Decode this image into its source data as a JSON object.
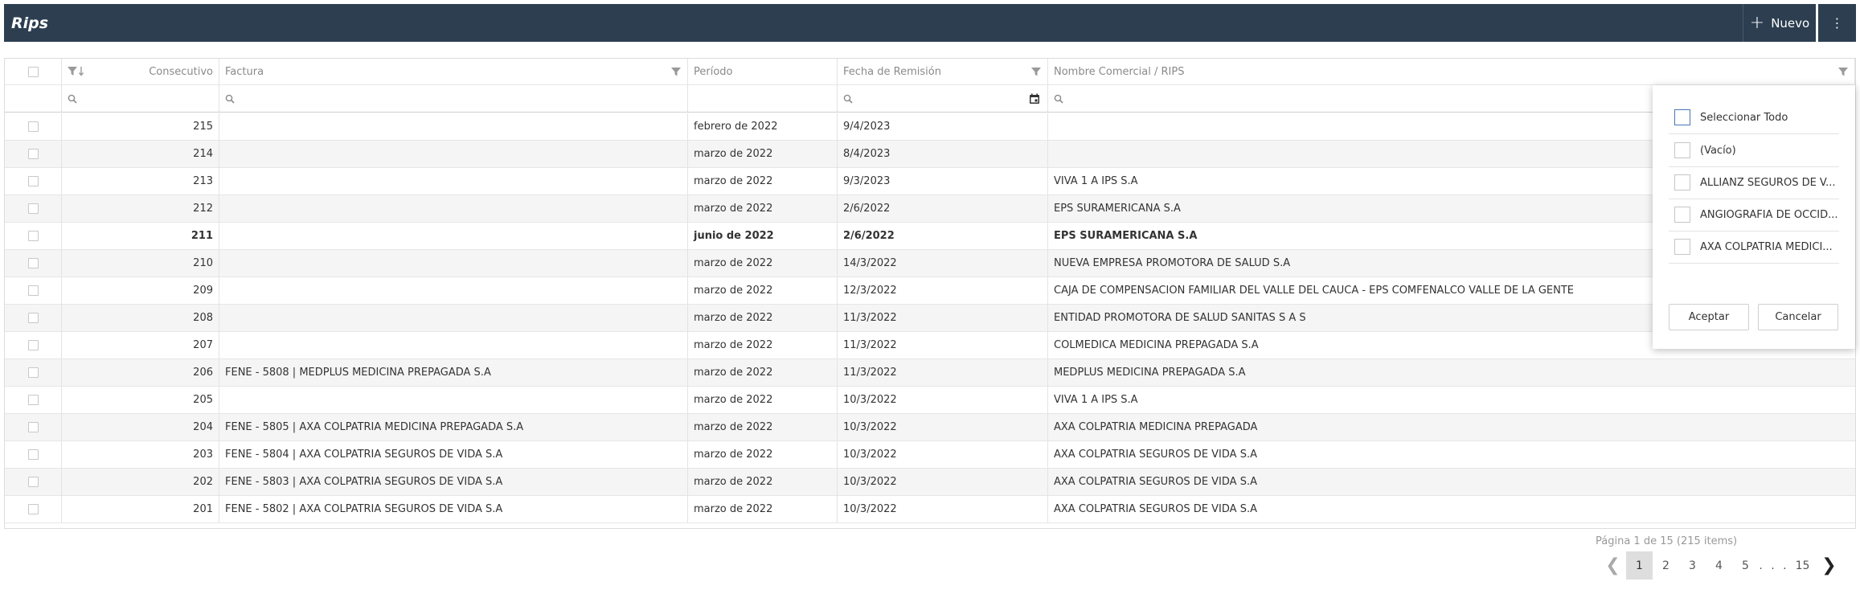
{
  "header": {
    "title": "Rips",
    "new_label": "Nuevo"
  },
  "columns": {
    "consecutivo": "Consecutivo",
    "factura": "Factura",
    "periodo": "Período",
    "fecha": "Fecha de Remisión",
    "nombre": "Nombre Comercial / RIPS"
  },
  "rows": [
    {
      "consecutivo": "215",
      "factura": "",
      "periodo": "febrero de 2022",
      "fecha": "9/4/2023",
      "nombre": ""
    },
    {
      "consecutivo": "214",
      "factura": "",
      "periodo": "marzo de 2022",
      "fecha": "8/4/2023",
      "nombre": ""
    },
    {
      "consecutivo": "213",
      "factura": "",
      "periodo": "marzo de 2022",
      "fecha": "9/3/2023",
      "nombre": "VIVA 1 A IPS S.A"
    },
    {
      "consecutivo": "212",
      "factura": "",
      "periodo": "marzo de 2022",
      "fecha": "2/6/2022",
      "nombre": "EPS SURAMERICANA S.A"
    },
    {
      "consecutivo": "211",
      "factura": "",
      "periodo": "junio de 2022",
      "fecha": "2/6/2022",
      "nombre": "EPS SURAMERICANA S.A"
    },
    {
      "consecutivo": "210",
      "factura": "",
      "periodo": "marzo de 2022",
      "fecha": "14/3/2022",
      "nombre": "NUEVA EMPRESA PROMOTORA DE SALUD S.A"
    },
    {
      "consecutivo": "209",
      "factura": "",
      "periodo": "marzo de 2022",
      "fecha": "12/3/2022",
      "nombre": "CAJA DE COMPENSACION FAMILIAR DEL VALLE DEL CAUCA - EPS COMFENALCO VALLE DE LA GENTE"
    },
    {
      "consecutivo": "208",
      "factura": "",
      "periodo": "marzo de 2022",
      "fecha": "11/3/2022",
      "nombre": "ENTIDAD PROMOTORA DE SALUD SANITAS S A S"
    },
    {
      "consecutivo": "207",
      "factura": "",
      "periodo": "marzo de 2022",
      "fecha": "11/3/2022",
      "nombre": "COLMEDICA MEDICINA PREPAGADA S.A"
    },
    {
      "consecutivo": "206",
      "factura": "FENE - 5808 | MEDPLUS MEDICINA PREPAGADA S.A",
      "periodo": "marzo de 2022",
      "fecha": "11/3/2022",
      "nombre": "MEDPLUS MEDICINA PREPAGADA S.A"
    },
    {
      "consecutivo": "205",
      "factura": "",
      "periodo": "marzo de 2022",
      "fecha": "10/3/2022",
      "nombre": "VIVA 1 A IPS S.A"
    },
    {
      "consecutivo": "204",
      "factura": "FENE - 5805 | AXA COLPATRIA MEDICINA PREPAGADA S.A",
      "periodo": "marzo de 2022",
      "fecha": "10/3/2022",
      "nombre": "AXA COLPATRIA MEDICINA PREPAGADA"
    },
    {
      "consecutivo": "203",
      "factura": "FENE - 5804 | AXA COLPATRIA SEGUROS DE VIDA S.A",
      "periodo": "marzo de 2022",
      "fecha": "10/3/2022",
      "nombre": "AXA COLPATRIA SEGUROS DE VIDA S.A"
    },
    {
      "consecutivo": "202",
      "factura": "FENE - 5803 | AXA COLPATRIA SEGUROS DE VIDA S.A",
      "periodo": "marzo de 2022",
      "fecha": "10/3/2022",
      "nombre": "AXA COLPATRIA SEGUROS DE VIDA S.A"
    },
    {
      "consecutivo": "201",
      "factura": "FENE - 5802 | AXA COLPATRIA SEGUROS DE VIDA S.A",
      "periodo": "marzo de 2022",
      "fecha": "10/3/2022",
      "nombre": "AXA COLPATRIA SEGUROS DE VIDA S.A"
    }
  ],
  "pager": {
    "info": "Página 1 de 15 (215 items)",
    "pages": [
      "1",
      "2",
      "3",
      "4",
      "5"
    ],
    "dots": ". . .",
    "last": "15",
    "prev": "❮",
    "next": "❯"
  },
  "filter_popup": {
    "items": [
      "Seleccionar Todo",
      "(Vacío)",
      "ALLIANZ SEGUROS DE V...",
      "ANGIOGRAFIA DE OCCID...",
      "AXA COLPATRIA MEDICI..."
    ],
    "accept": "Aceptar",
    "cancel": "Cancelar"
  }
}
